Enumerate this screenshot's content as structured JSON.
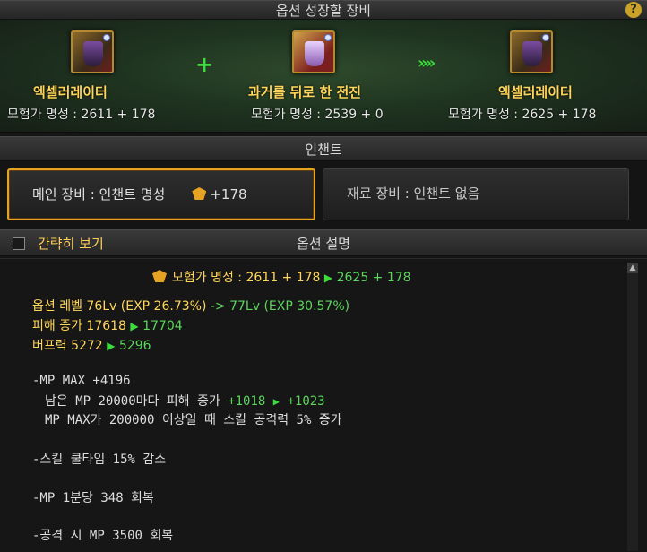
{
  "title": "옵션 성장할 장비",
  "help_label": "?",
  "source": {
    "name": "엑셀러레이터",
    "fame": "모험가 명성 : 2611 + 178"
  },
  "material": {
    "name": "과거를 뒤로 한 전진",
    "fame": "모험가 명성 : 2539 + 0"
  },
  "result": {
    "name": "엑셀러레이터",
    "fame": "모험가 명성 : 2625 + 178"
  },
  "plus_symbol": "+",
  "arrow_symbol": "»»",
  "enchant_title": "인챈트",
  "main_tab": {
    "label": "메인 장비 : 인챈트 명성",
    "value": "+178"
  },
  "material_tab": {
    "label": "재료 장비 : 인챈트 없음"
  },
  "simple_view_label": "간략히 보기",
  "desc_title": "옵션 설명",
  "fame_change": {
    "label": "모험가 명성 : 2611 + 178",
    "new": "2625 + 178"
  },
  "option_level": {
    "from": "옵션 레벨 76Lv (EXP 26.73%)",
    "arrow": "->",
    "to": "77Lv (EXP 30.57%)"
  },
  "damage": {
    "label": "피해 증가 17618",
    "new": "17704"
  },
  "buff": {
    "label": "버프력 5272",
    "new": "5296"
  },
  "mp_max": "-MP MAX +4196",
  "mp_damage": {
    "label": "남은 MP 20000마다 피해 증가",
    "from": "+1018",
    "to": "+1023"
  },
  "mp_skill": "MP MAX가 200000 이상일 때 스킬 공격력 5% 증가",
  "cooldown": "-스킬 쿨타임 15% 감소",
  "mp_regen": "-MP 1분당 348 회복",
  "mp_on_hit": "-공격 시 MP 3500 회복",
  "scroll_up_glyph": "▲"
}
